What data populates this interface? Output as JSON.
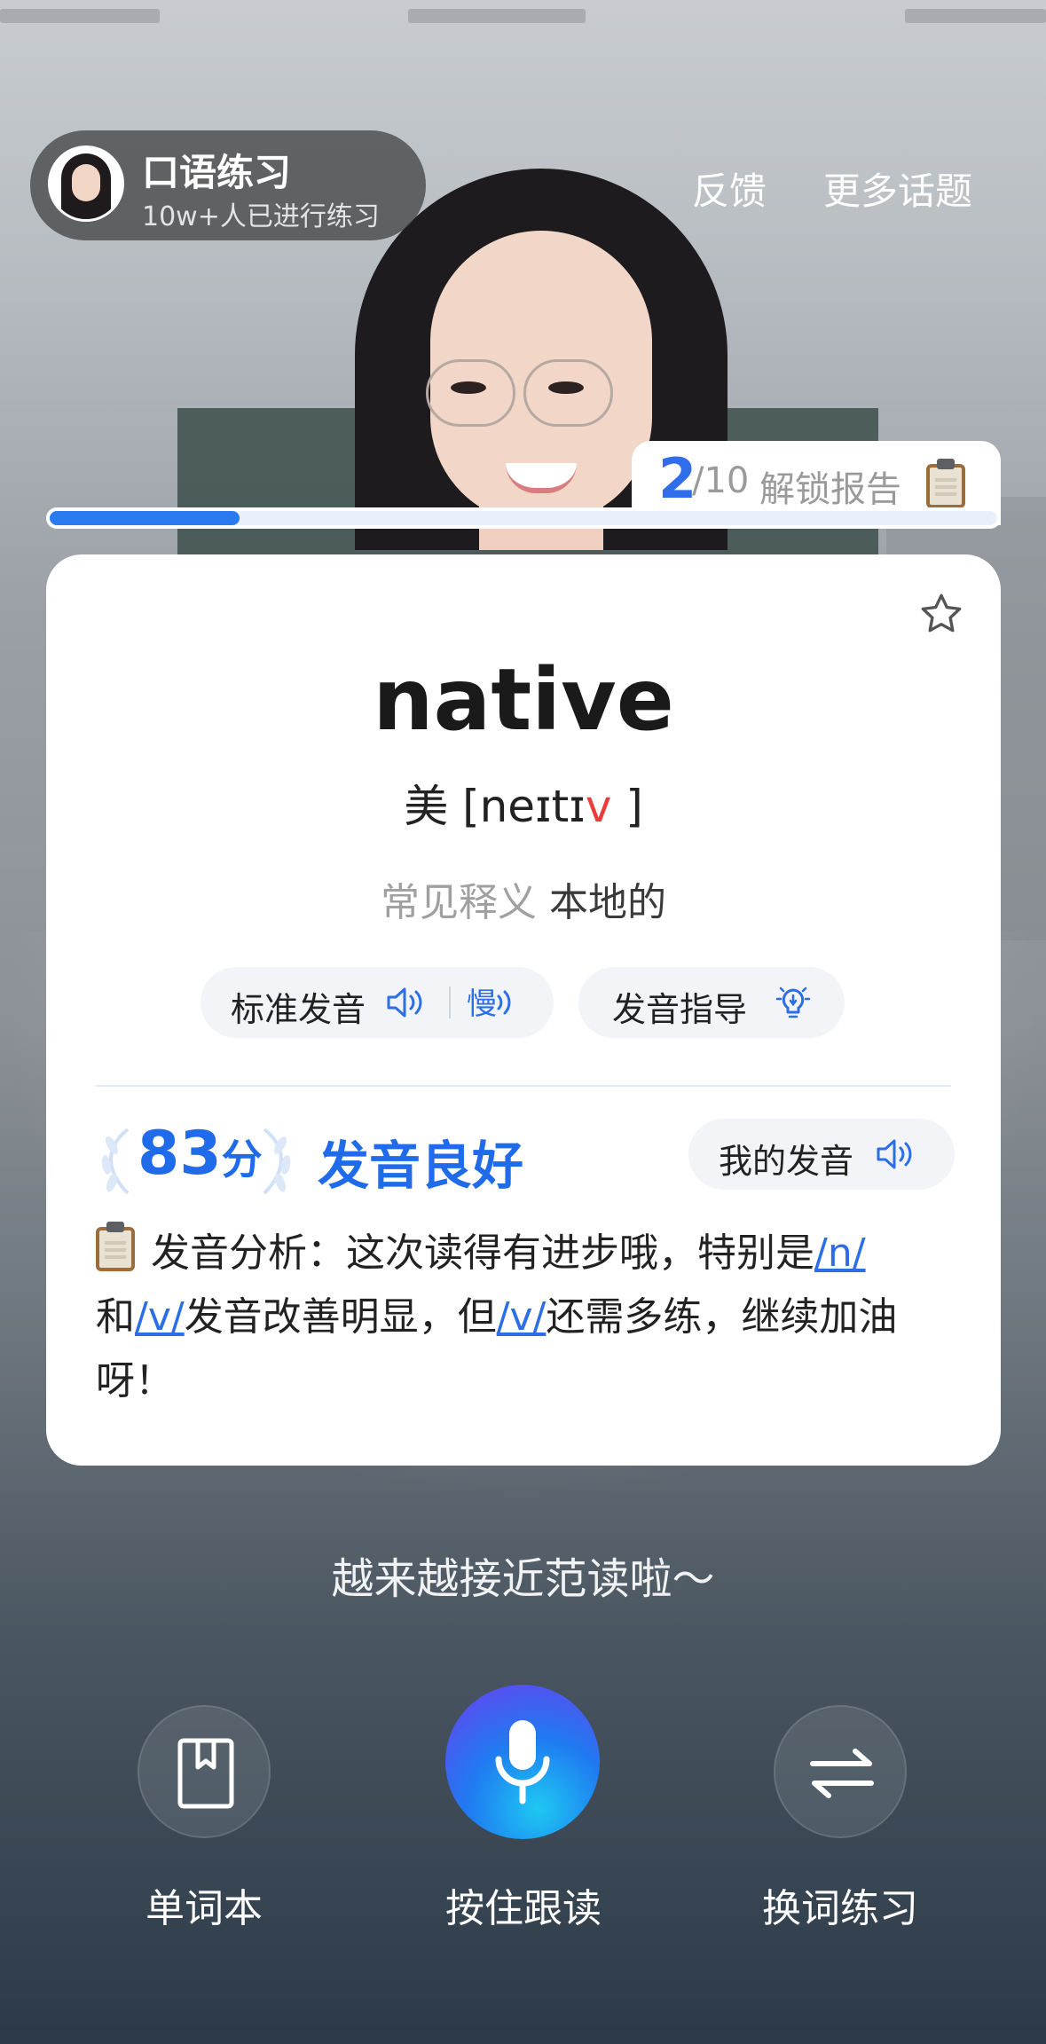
{
  "header": {
    "topic_title": "口语练习",
    "topic_subtitle": "10w+人已进行练习",
    "feedback_label": "反馈",
    "more_topics_label": "更多话题"
  },
  "progress": {
    "current": "2",
    "total": "/10",
    "unlock_label": "解锁报告",
    "fraction": 0.2
  },
  "word_card": {
    "word": "native",
    "phonetic_prefix": "美 [neɪtɪ",
    "phonetic_highlight": "v",
    "phonetic_suffix": " ]",
    "meaning_label": "常见释义",
    "meaning_value": "本地的",
    "standard_pronunciation_label": "标准发音",
    "slow_icon_char": "慢",
    "guide_label": "发音指导",
    "score": "83",
    "score_unit": "分",
    "grade": "发音良好",
    "my_pronunciation_label": "我的发音",
    "analysis": {
      "part1": "发音分析：这次读得有进步哦，特别是",
      "link1": "/n/",
      "part2": "和",
      "link2": "/v/",
      "part3": "发音改善明显，但",
      "link3": "/v/",
      "part4": "还需多练，继续加油呀！"
    }
  },
  "encourage_text": "越来越接近范读啦～",
  "controls": {
    "wordbook_label": "单词本",
    "hold_to_read_label": "按住跟读",
    "switch_word_label": "换词练习"
  },
  "colors": {
    "accent": "#1f6bea",
    "highlight_red": "#ec3b3b"
  }
}
